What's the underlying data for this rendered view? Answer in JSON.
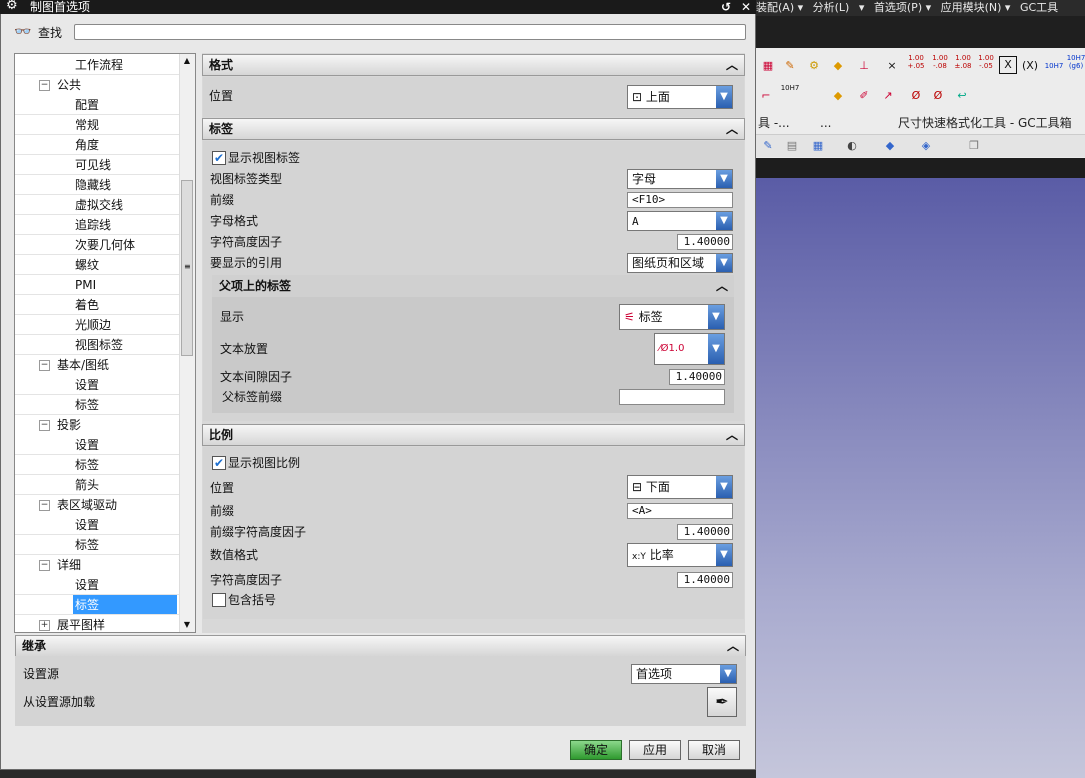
{
  "window_title": "制图首选项",
  "search": {
    "label": "查找",
    "value": ""
  },
  "background": {
    "menu_items": [
      "装配(A) ▾",
      "分析(L)",
      "▾",
      "首选项(P) ▾",
      "应用模块(N) ▾",
      "GC工具"
    ],
    "toolbar_labels": {
      "left": "具 -...",
      "center": "...",
      "right": "尺寸快速格式化工具 - GC工具箱"
    },
    "format_values": [
      "1.00 +.05",
      "1.00 -.08",
      "1.00 ±.08",
      "1.00 -.05"
    ],
    "fit_labels": [
      "10H7",
      "10H7 (g6)"
    ],
    "fit_label_2": "10H7"
  },
  "tree": {
    "items": [
      {
        "label": "工作流程",
        "level": 2
      },
      {
        "label": "公共",
        "level": 1,
        "toggle": "⊖"
      },
      {
        "label": "配置",
        "level": 2
      },
      {
        "label": "常规",
        "level": 2
      },
      {
        "label": "角度",
        "level": 2
      },
      {
        "label": "可见线",
        "level": 2
      },
      {
        "label": "隐藏线",
        "level": 2
      },
      {
        "label": "虚拟交线",
        "level": 2
      },
      {
        "label": "追踪线",
        "level": 2
      },
      {
        "label": "次要几何体",
        "level": 2
      },
      {
        "label": "螺纹",
        "level": 2
      },
      {
        "label": "PMI",
        "level": 2
      },
      {
        "label": "着色",
        "level": 2
      },
      {
        "label": "光顺边",
        "level": 2
      },
      {
        "label": "视图标签",
        "level": 2
      },
      {
        "label": "基本/图纸",
        "level": 1,
        "toggle": "⊖"
      },
      {
        "label": "设置",
        "level": 2
      },
      {
        "label": "标签",
        "level": 2
      },
      {
        "label": "投影",
        "level": 1,
        "toggle": "⊖"
      },
      {
        "label": "设置",
        "level": 2
      },
      {
        "label": "标签",
        "level": 2
      },
      {
        "label": "箭头",
        "level": 2
      },
      {
        "label": "表区域驱动",
        "level": 1,
        "toggle": "⊖"
      },
      {
        "label": "设置",
        "level": 2
      },
      {
        "label": "标签",
        "level": 2
      },
      {
        "label": "详细",
        "level": 1,
        "toggle": "⊖"
      },
      {
        "label": "设置",
        "level": 2
      },
      {
        "label": "标签",
        "level": 2,
        "selected": true
      },
      {
        "label": "展平图样",
        "level": 1,
        "toggle": "⊕"
      }
    ]
  },
  "format": {
    "title": "格式",
    "position_label": "位置",
    "position_value": "上面"
  },
  "label": {
    "title": "标签",
    "show_view_label": "显示视图标签",
    "label_type_label": "视图标签类型",
    "label_type_value": "字母",
    "prefix_label": "前缀",
    "prefix_value": "<F10>",
    "letter_format_label": "字母格式",
    "letter_format_value": "A",
    "char_height_label": "字符高度因子",
    "char_height_value": "1.40000",
    "ref_label": "要显示的引用",
    "ref_value": "图纸页和区域",
    "parent": {
      "title": "父项上的标签",
      "display_label": "显示",
      "display_value": "标签",
      "text_placement_label": "文本放置",
      "text_placement_value": "Ø1.0",
      "text_gap_label": "文本间隙因子",
      "text_gap_value": "1.40000",
      "parent_prefix_label": "父标签前缀",
      "parent_prefix_value": ""
    }
  },
  "scale": {
    "title": "比例",
    "show_view_scale": "显示视图比例",
    "position_label": "位置",
    "position_value": "下面",
    "prefix_label": "前缀",
    "prefix_value": "<A>",
    "prefix_height_label": "前缀字符高度因子",
    "prefix_height_value": "1.40000",
    "num_format_label": "数值格式",
    "num_format_icon": "x:Y",
    "num_format_value": "比率",
    "char_height_label": "字符高度因子",
    "char_height_value": "1.40000",
    "include_brackets": "包含括号"
  },
  "inherit": {
    "title": "继承",
    "source_label": "设置源",
    "source_value": "首选项",
    "load_label": "从设置源加载"
  },
  "buttons": {
    "ok": "确定",
    "apply": "应用",
    "cancel": "取消"
  }
}
